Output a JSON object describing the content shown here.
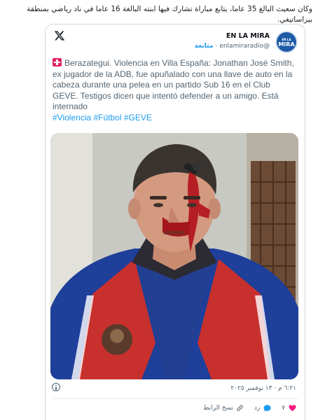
{
  "caption": "وكان سعيث البالغ 35 عاما، يتابع مباراة تشارك فيها ابنته البالغة 16 عاما في ناد رياضي بمنطقة بيراساتيغي.",
  "embed": {
    "author_name": "EN LA MIRA",
    "author_handle": "@enlamiraradio",
    "follow_label": "متابعة",
    "avatar_text_top": "EN LA",
    "avatar_text_main": "MIRA",
    "post_text": "Berazategui. Violencia en Villa España: Jonathan José Smith, ex jugador de la ADB, fue apuñalado con una llave de auto en la cabeza durante una pelea en un partido Sub 16 en el Club GEVE. Testigos dicen que intentó defender a un amigo. Está internado",
    "hashtags": "#Violencia #Fútbol #GEVE",
    "timestamp": "٦:٢١ م · ١٣ نوفمبر ٢٠٢٥",
    "likes_count": "٧",
    "reply_label": "رد",
    "copy_link_label": "نسخ الرابط",
    "colors": {
      "accent": "#1d9bf0",
      "like": "#f91880",
      "text_muted": "#536471"
    }
  }
}
